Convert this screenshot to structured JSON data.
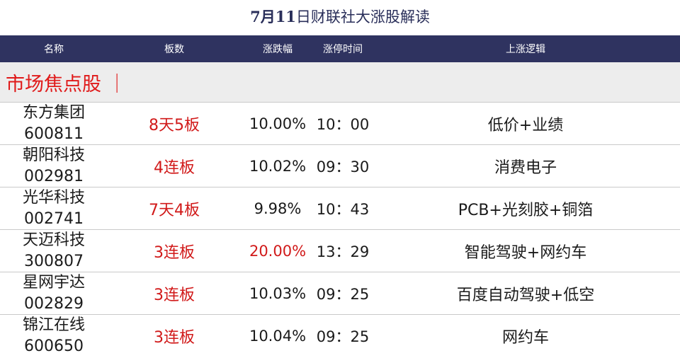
{
  "title": {
    "prefix_bold": "7月11",
    "rest": "日财联社大涨股解读"
  },
  "headers": {
    "name": "名称",
    "boards": "板数",
    "change": "涨跌幅",
    "limit_time": "涨停时间",
    "logic": "上涨逻辑"
  },
  "section_label": "市场焦点股 ｜",
  "rows": [
    {
      "name": "东方集团",
      "code": "600811",
      "boards": "8天5板",
      "change": "10.00%",
      "change_red": false,
      "time": "10：00",
      "logic": "低价+业绩"
    },
    {
      "name": "朝阳科技",
      "code": "002981",
      "boards": "4连板",
      "change": "10.02%",
      "change_red": false,
      "time": "09：30",
      "logic": "消费电子"
    },
    {
      "name": "光华科技",
      "code": "002741",
      "boards": "7天4板",
      "change": "9.98%",
      "change_red": false,
      "time": "10：43",
      "logic": "PCB+光刻胶+铜箔"
    },
    {
      "name": "天迈科技",
      "code": "300807",
      "boards": "3连板",
      "change": "20.00%",
      "change_red": true,
      "time": "13：29",
      "logic": "智能驾驶+网约车"
    },
    {
      "name": "星网宇达",
      "code": "002829",
      "boards": "3连板",
      "change": "10.03%",
      "change_red": false,
      "time": "09：25",
      "logic": "百度自动驾驶+低空"
    },
    {
      "name": "锦江在线",
      "code": "600650",
      "boards": "3连板",
      "change": "10.04%",
      "change_red": false,
      "time": "09：25",
      "logic": "网约车"
    }
  ],
  "colors": {
    "header_bg": "#2f3360",
    "accent_red": "#d11a1a",
    "section_bg": "#ededed"
  }
}
